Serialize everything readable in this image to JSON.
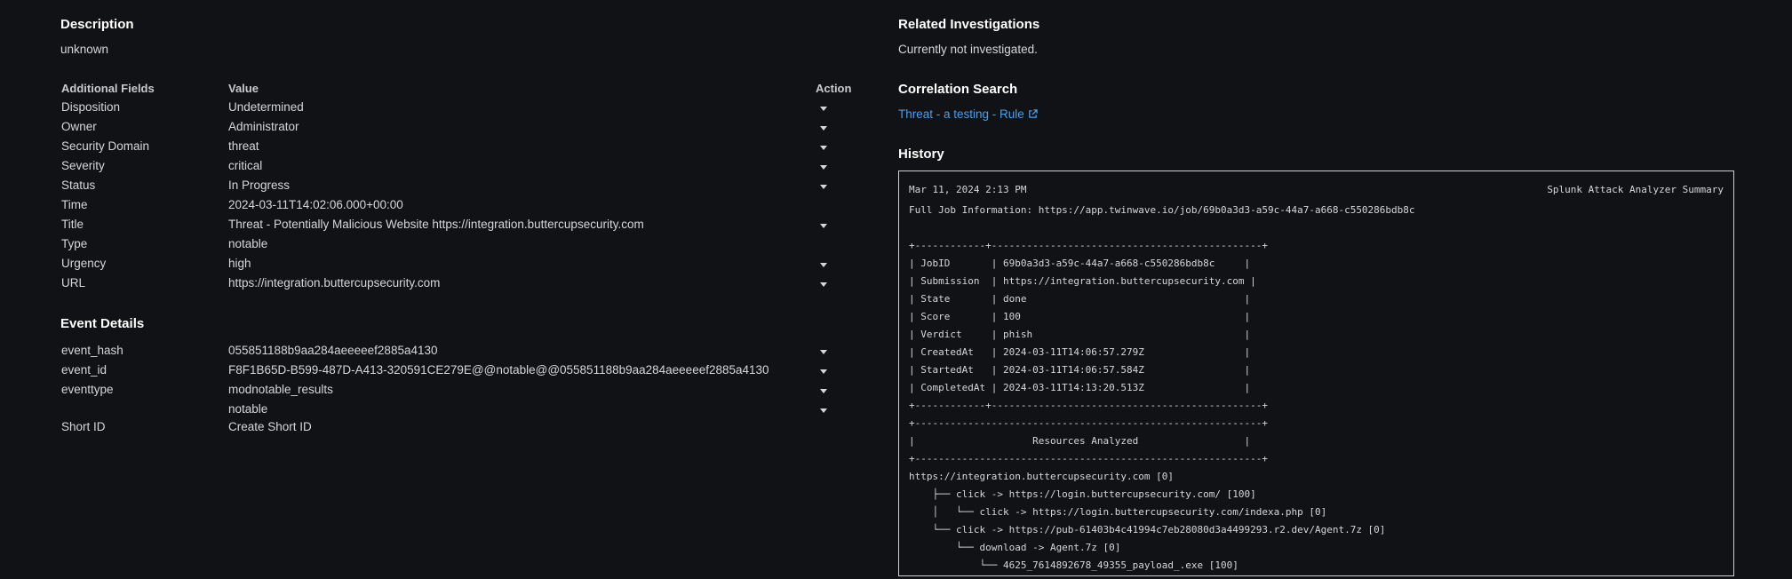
{
  "description": {
    "heading": "Description",
    "value": "unknown"
  },
  "fields": {
    "headers": {
      "field": "Additional Fields",
      "value": "Value",
      "action": "Action"
    },
    "rows": [
      {
        "name": "Disposition",
        "value": "Undetermined",
        "has_action": true
      },
      {
        "name": "Owner",
        "value": "Administrator",
        "has_action": true
      },
      {
        "name": "Security Domain",
        "value": "threat",
        "has_action": true
      },
      {
        "name": "Severity",
        "value": "critical",
        "has_action": true
      },
      {
        "name": "Status",
        "value": "In Progress",
        "has_action": true
      },
      {
        "name": "Time",
        "value": "2024-03-11T14:02:06.000+00:00",
        "has_action": false
      },
      {
        "name": "Title",
        "value": "Threat - Potentially Malicious Website https://integration.buttercupsecurity.com",
        "has_action": true
      },
      {
        "name": "Type",
        "value": "notable",
        "has_action": false
      },
      {
        "name": "Urgency",
        "value": "high",
        "has_action": true
      },
      {
        "name": "URL",
        "value": "https://integration.buttercupsecurity.com",
        "has_action": true
      }
    ]
  },
  "event_details": {
    "heading": "Event Details",
    "rows": [
      {
        "name": "event_hash",
        "value": "055851188b9aa284aeeeeef2885a4130",
        "has_action": true
      },
      {
        "name": "event_id",
        "value": "F8F1B65D-B599-487D-A413-320591CE279E@@notable@@055851188b9aa284aeeeeef2885a4130",
        "has_action": true
      },
      {
        "name": "eventtype",
        "value": "modnotable_results",
        "has_action": true
      },
      {
        "name": "",
        "value": "notable",
        "has_action": true
      }
    ],
    "short_id": {
      "name": "Short ID",
      "link": "Create Short ID"
    }
  },
  "related": {
    "heading": "Related Investigations",
    "value": "Currently not investigated."
  },
  "correlation": {
    "heading": "Correlation Search",
    "link": "Threat - a testing - Rule"
  },
  "history": {
    "heading": "History",
    "date": "Mar 11, 2024 2:13 PM",
    "summary_title": "Splunk Attack Analyzer Summary",
    "lines": [
      "Full Job Information: https://app.twinwave.io/job/69b0a3d3-a59c-44a7-a668-c550286bdb8c",
      "+------------+----------------------------------------------+",
      "| JobID       | 69b0a3d3-a59c-44a7-a668-c550286bdb8c     |",
      "| Submission  | https://integration.buttercupsecurity.com |",
      "| State       | done                                     |",
      "| Score       | 100                                      |",
      "| Verdict     | phish                                    |",
      "| CreatedAt   | 2024-03-11T14:06:57.279Z                 |",
      "| StartedAt   | 2024-03-11T14:06:57.584Z                 |",
      "| CompletedAt | 2024-03-11T14:13:20.513Z                 |",
      "+------------+----------------------------------------------+",
      "+-----------------------------------------------------------+",
      "|                    Resources Analyzed                  |",
      "+-----------------------------------------------------------+",
      "https://integration.buttercupsecurity.com [0]",
      "    ├── click -> https://login.buttercupsecurity.com/ [100]",
      "    │   └── click -> https://login.buttercupsecurity.com/indexa.php [0]",
      "    └── click -> https://pub-61403b4c41994c7eb28080d3a4499293.r2.dev/Agent.7z [0]",
      "        └── download -> Agent.7z [0]",
      "            └── 4625_7614892678_49355_payload_.exe [100]"
    ]
  },
  "colors": {
    "background": "#111215",
    "text": "#d6d7da",
    "link": "#4a9fec",
    "heading": "#ffffff"
  }
}
